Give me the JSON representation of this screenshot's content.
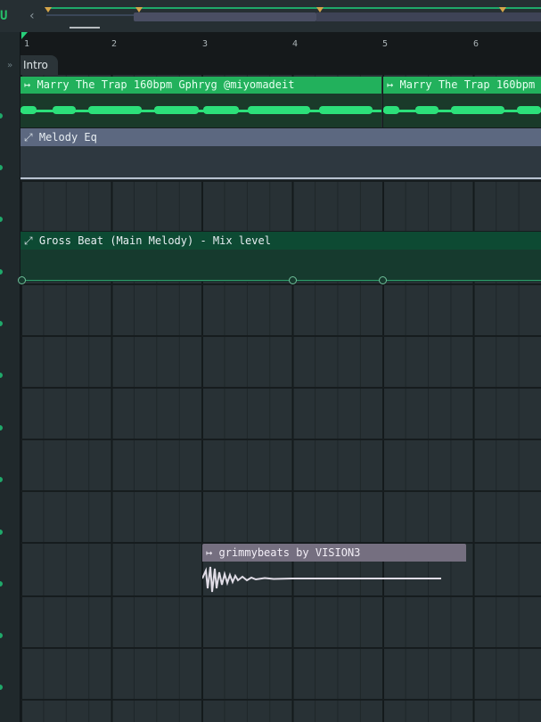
{
  "ruler": {
    "bar_numbers": [
      "1",
      "2",
      "3",
      "4",
      "5",
      "6"
    ]
  },
  "marker": {
    "label": "Intro"
  },
  "tracks": {
    "audio_clip_1": {
      "label": "Marry The Trap 160bpm Gphryg @miyomadeit",
      "color": "#22b15c"
    },
    "audio_clip_2": {
      "label": "Marry The Trap 160bpm",
      "color": "#22b15c"
    },
    "automation_1": {
      "label": "Melody Eq",
      "color": "#5c6880"
    },
    "automation_2": {
      "label": "Gross Beat (Main Melody) - Mix level",
      "color": "#0d4a33"
    },
    "audio_clip_3": {
      "label": "grimmybeats by VISION3",
      "color": "#756f80"
    }
  },
  "icons": {
    "audio_clip": "play-arrow-icon",
    "automation": "automation-curve-icon",
    "snap": "snap-magnet-icon",
    "scroll_left": "chevron-left-icon"
  }
}
